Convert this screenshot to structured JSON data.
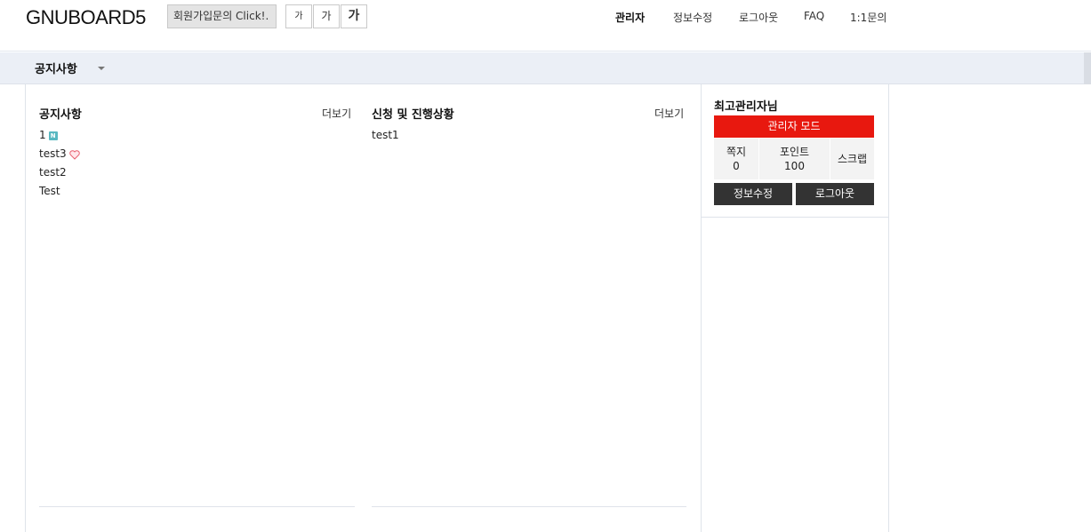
{
  "header": {
    "logo": "GNUBOARD5",
    "notice_box": "회원가입문의 Click!.",
    "font_sizes": [
      "가",
      "가",
      "가"
    ],
    "nav": [
      "관리자",
      "정보수정",
      "로그아웃",
      "FAQ",
      "1:1문의"
    ]
  },
  "gnb": {
    "items": [
      {
        "label": "공지사항"
      }
    ]
  },
  "latest": [
    {
      "title": "공지사항",
      "more": "더보기",
      "posts": [
        {
          "subject": "1",
          "icon": "new-icon",
          "icon_text": "N"
        },
        {
          "subject": "test3",
          "icon": "heart-icon"
        },
        {
          "subject": "test2"
        },
        {
          "subject": "Test"
        }
      ]
    },
    {
      "title": "신청 및 진행상황",
      "more": "더보기",
      "posts": [
        {
          "subject": "test1"
        }
      ]
    }
  ],
  "outlogin": {
    "nickname": "최고관리자님",
    "admin_mode": "관리자 모드",
    "stats": [
      {
        "label": "쪽지",
        "value": "0"
      },
      {
        "label": "포인트",
        "value": "100"
      },
      {
        "label": "스크랩",
        "value": ""
      }
    ],
    "edit_button": "정보수정",
    "logout_button": "로그아웃"
  },
  "colors": {
    "admin_mode_bg": "#e8180f",
    "gnb_bg": "#ebeff6",
    "new_icon": "#59b8c1",
    "dark_button": "#333333"
  }
}
